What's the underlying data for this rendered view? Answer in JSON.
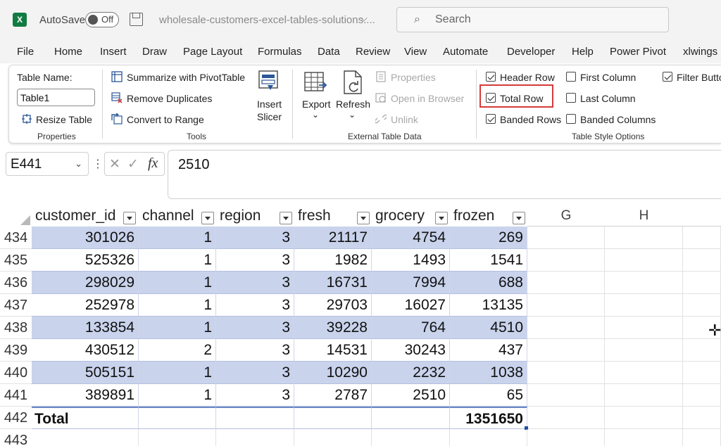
{
  "titlebar": {
    "app_icon": "X",
    "autosave_label": "AutoSave",
    "autosave_state": "Off",
    "document_title": "wholesale-customers-excel-tables-solutions....",
    "search_placeholder": "Search"
  },
  "menu": {
    "tabs": [
      "File",
      "Home",
      "Insert",
      "Draw",
      "Page Layout",
      "Formulas",
      "Data",
      "Review",
      "View",
      "Automate",
      "Developer",
      "Help",
      "Power Pivot",
      "xlwings"
    ]
  },
  "ribbon": {
    "properties": {
      "table_name_label": "Table Name:",
      "table_name_value": "Table1",
      "resize_label": "Resize Table",
      "group_label": "Properties"
    },
    "tools": {
      "summarize_label": "Summarize with PivotTable",
      "remove_dup_label": "Remove Duplicates",
      "convert_label": "Convert to Range",
      "insert_slicer_label_1": "Insert",
      "insert_slicer_label_2": "Slicer",
      "group_label": "Tools"
    },
    "external": {
      "export_label": "Export",
      "refresh_label": "Refresh",
      "properties_label": "Properties",
      "open_browser_label": "Open in Browser",
      "unlink_label": "Unlink",
      "group_label": "External Table Data"
    },
    "style_options": {
      "header_row": "Header Row",
      "total_row": "Total Row",
      "banded_rows": "Banded Rows",
      "first_column": "First Column",
      "last_column": "Last Column",
      "banded_columns": "Banded Columns",
      "filter_button": "Filter Butto",
      "group_label": "Table Style Options",
      "header_row_checked": true,
      "total_row_checked": true,
      "banded_rows_checked": true,
      "first_column_checked": false,
      "last_column_checked": false,
      "banded_columns_checked": false,
      "filter_button_checked": true
    }
  },
  "formula_bar": {
    "name_box": "E441",
    "formula": "2510"
  },
  "grid": {
    "headers": [
      "customer_id",
      "channel",
      "region",
      "fresh",
      "grocery",
      "frozen"
    ],
    "extra_columns": [
      "G",
      "H"
    ],
    "rows": [
      {
        "row": "434",
        "cells": [
          "301026",
          "1",
          "3",
          "21117",
          "4754",
          "269"
        ]
      },
      {
        "row": "435",
        "cells": [
          "525326",
          "1",
          "3",
          "1982",
          "1493",
          "1541"
        ]
      },
      {
        "row": "436",
        "cells": [
          "298029",
          "1",
          "3",
          "16731",
          "7994",
          "688"
        ]
      },
      {
        "row": "437",
        "cells": [
          "252978",
          "1",
          "3",
          "29703",
          "16027",
          "13135"
        ]
      },
      {
        "row": "438",
        "cells": [
          "133854",
          "1",
          "3",
          "39228",
          "764",
          "4510"
        ]
      },
      {
        "row": "439",
        "cells": [
          "430512",
          "2",
          "3",
          "14531",
          "30243",
          "437"
        ]
      },
      {
        "row": "440",
        "cells": [
          "505151",
          "1",
          "3",
          "10290",
          "2232",
          "1038"
        ]
      },
      {
        "row": "441",
        "cells": [
          "389891",
          "1",
          "3",
          "2787",
          "2510",
          "65"
        ]
      }
    ],
    "total_row": {
      "row": "442",
      "label": "Total",
      "frozen_total": "1351650"
    },
    "next_row": "443"
  }
}
